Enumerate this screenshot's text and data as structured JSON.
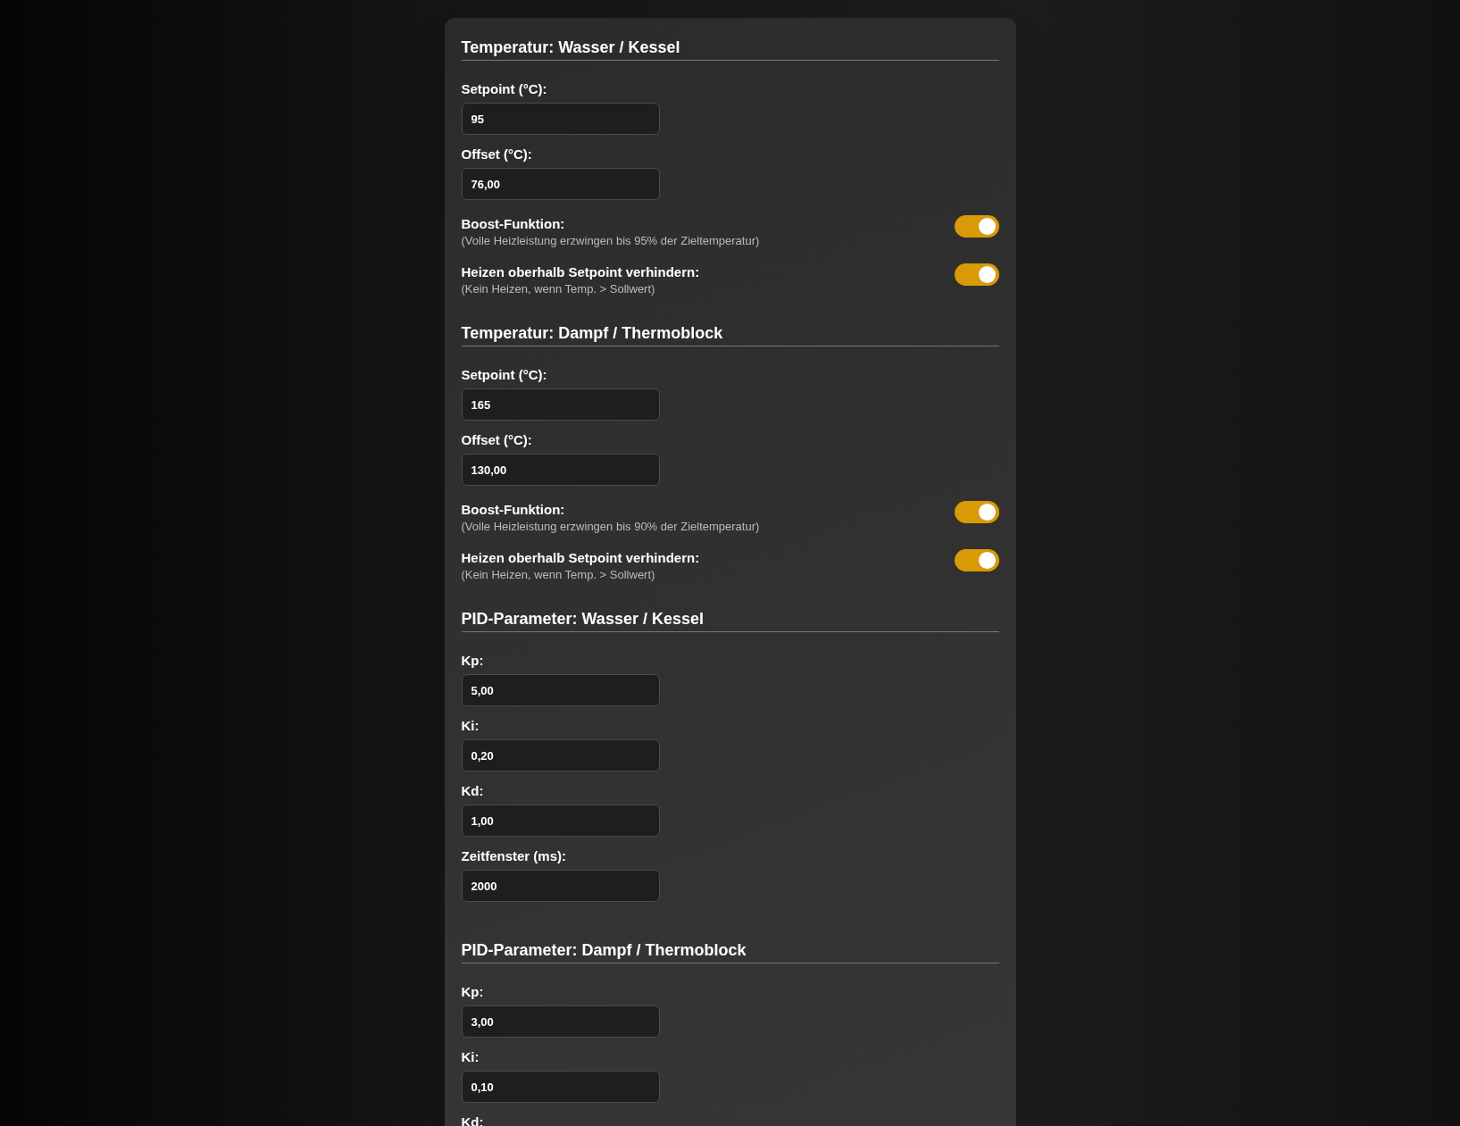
{
  "sections": [
    {
      "title": "Temperatur: Wasser / Kessel",
      "fields": [
        {
          "label": "Setpoint (°C):",
          "value": "95"
        },
        {
          "label": "Offset (°C):",
          "value": "76,00"
        }
      ],
      "toggles": [
        {
          "label": "Boost-Funktion:",
          "description": "(Volle Heizleistung erzwingen bis 95% der Zieltemperatur)",
          "on": true
        },
        {
          "label": "Heizen oberhalb Setpoint verhindern:",
          "description": "(Kein Heizen, wenn Temp. > Sollwert)",
          "on": true
        }
      ]
    },
    {
      "title": "Temperatur: Dampf / Thermoblock",
      "fields": [
        {
          "label": "Setpoint (°C):",
          "value": "165"
        },
        {
          "label": "Offset (°C):",
          "value": "130,00"
        }
      ],
      "toggles": [
        {
          "label": "Boost-Funktion:",
          "description": "(Volle Heizleistung erzwingen bis 90% der Zieltemperatur)",
          "on": true
        },
        {
          "label": "Heizen oberhalb Setpoint verhindern:",
          "description": "(Kein Heizen, wenn Temp. > Sollwert)",
          "on": true
        }
      ]
    },
    {
      "title": "PID-Parameter: Wasser / Kessel",
      "fields": [
        {
          "label": "Kp:",
          "value": "5,00"
        },
        {
          "label": "Ki:",
          "value": "0,20"
        },
        {
          "label": "Kd:",
          "value": "1,00"
        },
        {
          "label": "Zeitfenster (ms):",
          "value": "2000"
        }
      ]
    },
    {
      "title": "PID-Parameter: Dampf / Thermoblock",
      "fields": [
        {
          "label": "Kp:",
          "value": "3,00"
        },
        {
          "label": "Ki:",
          "value": "0,10"
        },
        {
          "label": "Kd:"
        }
      ]
    }
  ]
}
